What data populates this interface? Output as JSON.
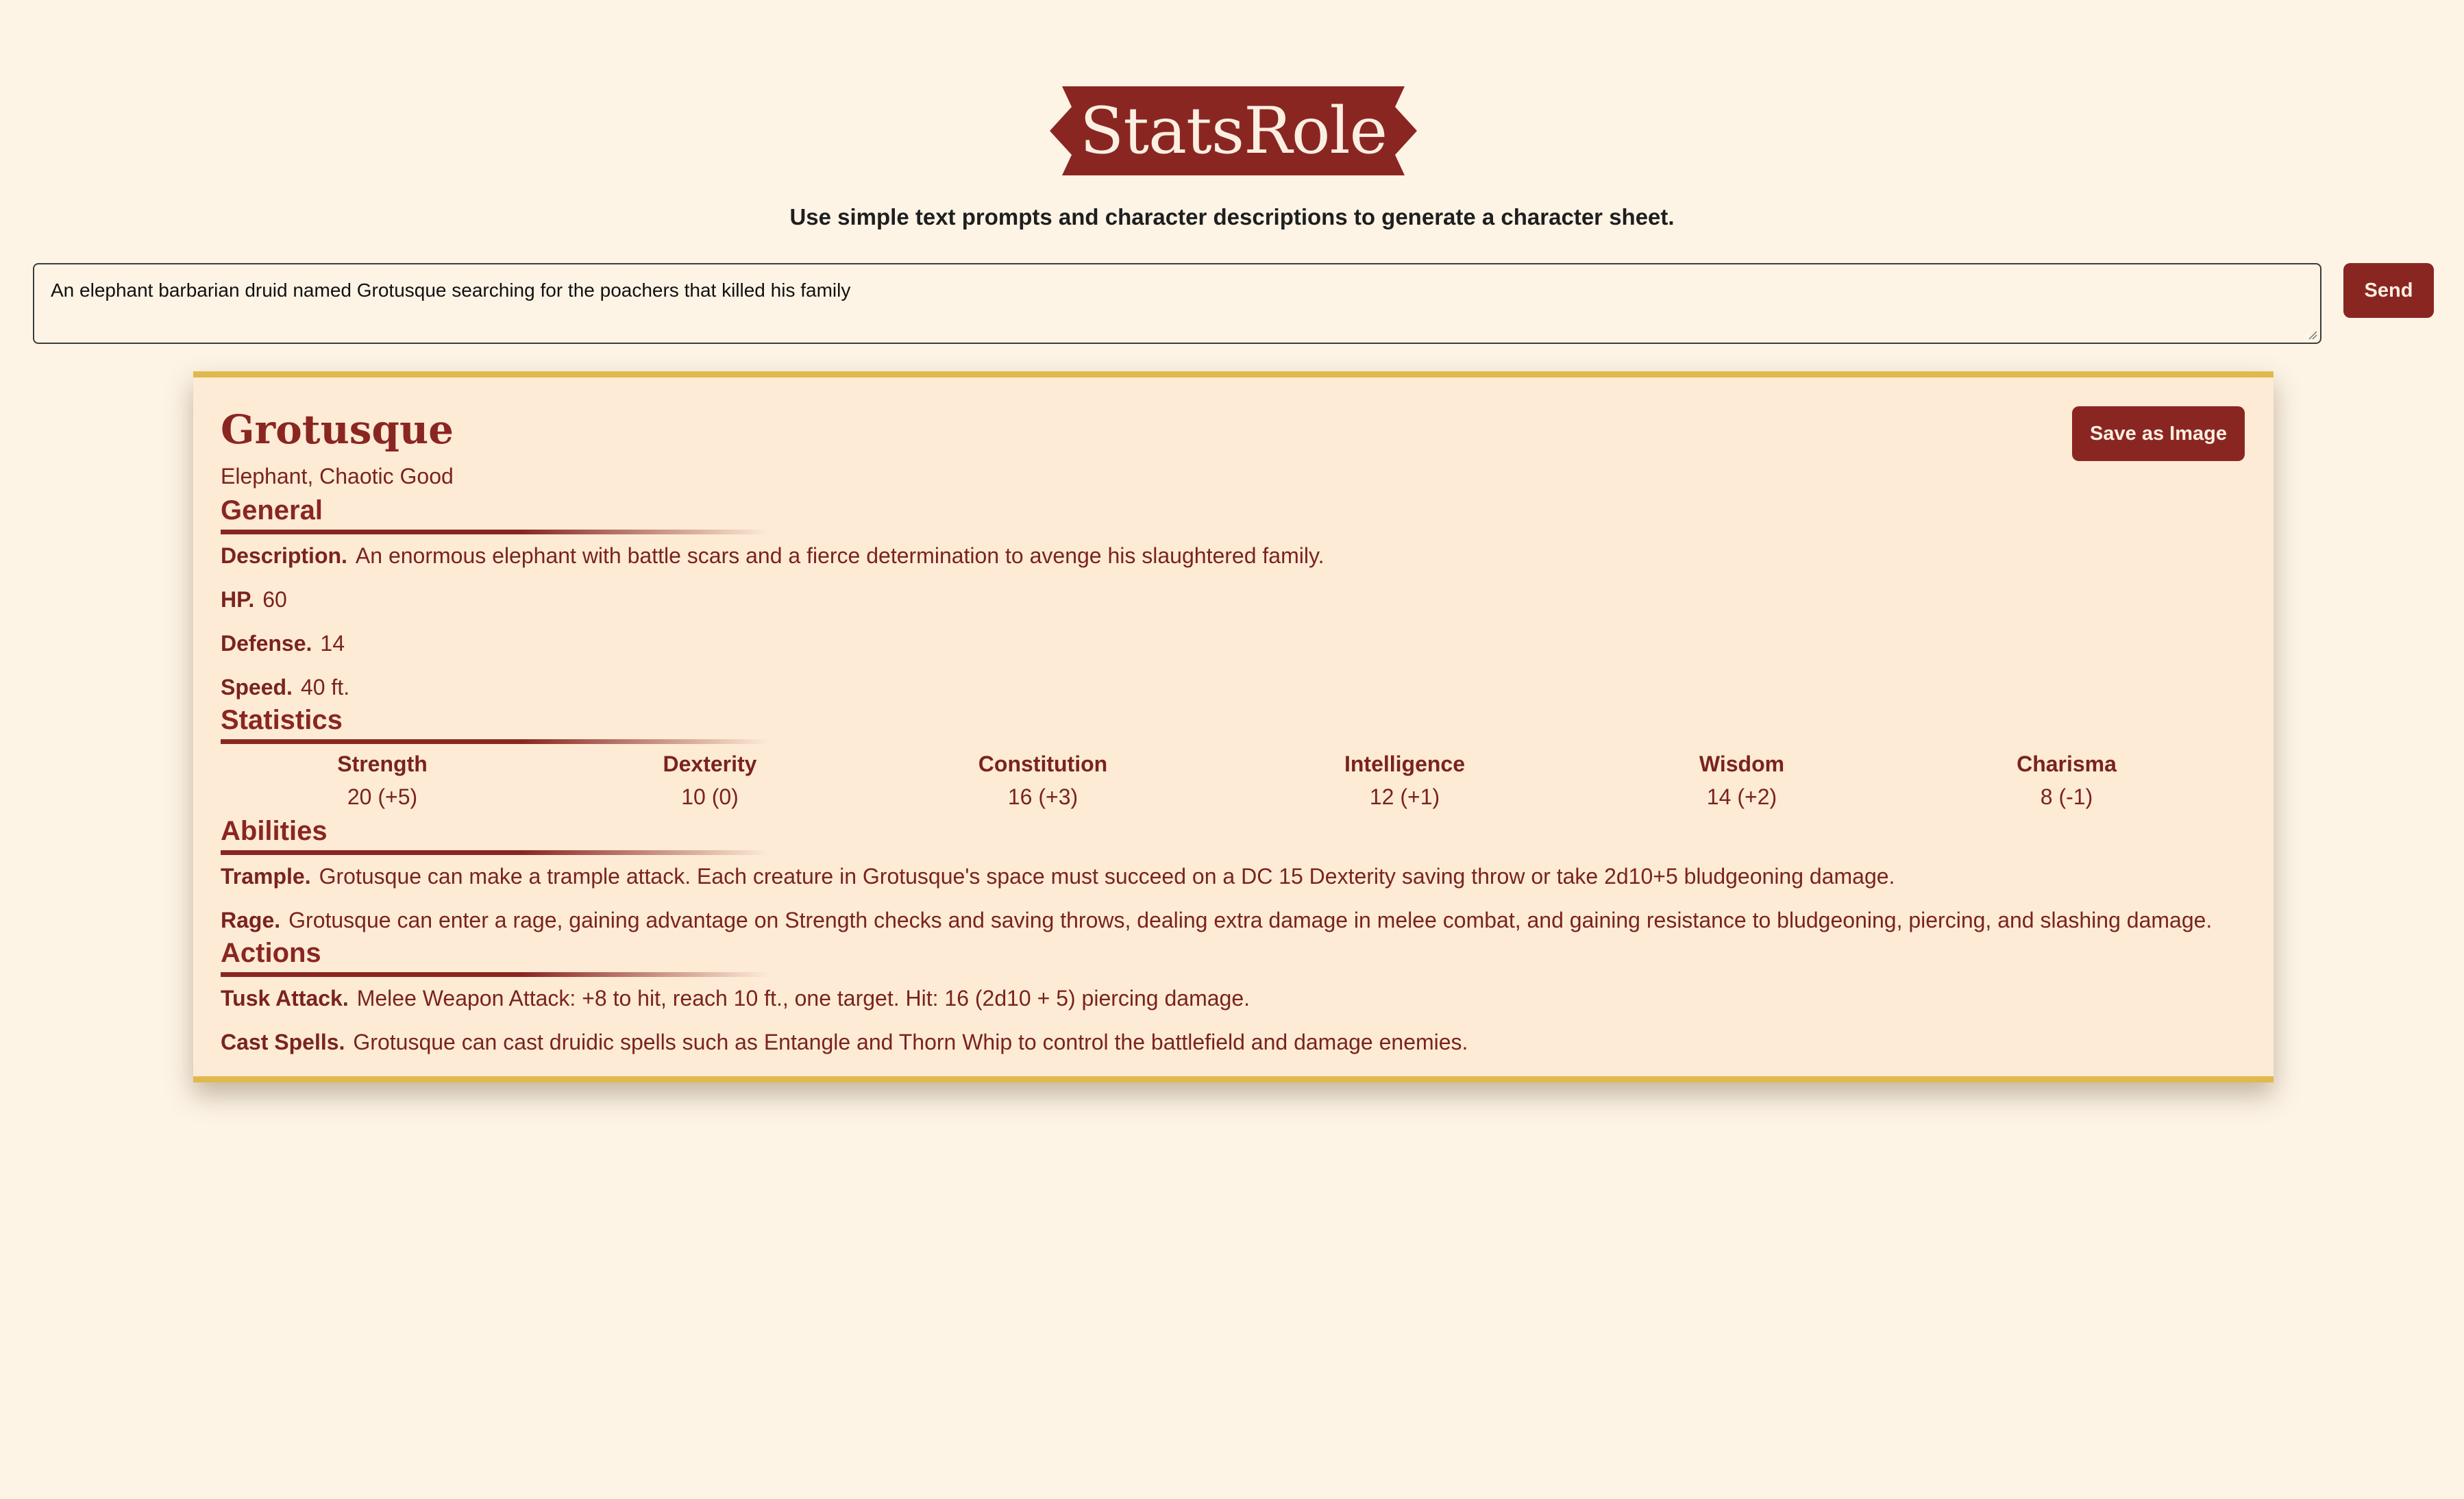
{
  "app": {
    "logo_text": "StatsRole",
    "tagline": "Use simple text prompts and character descriptions to generate a character sheet."
  },
  "prompt": {
    "value": "An elephant barbarian druid named Grotusque searching for the poachers that killed his family",
    "send_label": "Send"
  },
  "sheet": {
    "name": "Grotusque",
    "subtitle": "Elephant, Chaotic Good",
    "save_label": "Save as Image",
    "general": {
      "title": "General",
      "props": [
        {
          "label": "Description.",
          "value": "An enormous elephant with battle scars and a fierce determination to avenge his slaughtered family."
        },
        {
          "label": "HP.",
          "value": "60"
        },
        {
          "label": "Defense.",
          "value": "14"
        },
        {
          "label": "Speed.",
          "value": "40 ft."
        }
      ]
    },
    "statistics": {
      "title": "Statistics",
      "stats": [
        {
          "name": "Strength",
          "value": "20 (+5)"
        },
        {
          "name": "Dexterity",
          "value": "10 (0)"
        },
        {
          "name": "Constitution",
          "value": "16 (+3)"
        },
        {
          "name": "Intelligence",
          "value": "12 (+1)"
        },
        {
          "name": "Wisdom",
          "value": "14 (+2)"
        },
        {
          "name": "Charisma",
          "value": "8 (-1)"
        }
      ]
    },
    "abilities": {
      "title": "Abilities",
      "items": [
        {
          "label": "Trample.",
          "value": "Grotusque can make a trample attack. Each creature in Grotusque's space must succeed on a DC 15 Dexterity saving throw or take 2d10+5 bludgeoning damage."
        },
        {
          "label": "Rage.",
          "value": "Grotusque can enter a rage, gaining advantage on Strength checks and saving throws, dealing extra damage in melee combat, and gaining resistance to bludgeoning, piercing, and slashing damage."
        }
      ]
    },
    "actions": {
      "title": "Actions",
      "items": [
        {
          "label": "Tusk Attack.",
          "value": "Melee Weapon Attack: +8 to hit, reach 10 ft., one target. Hit: 16 (2d10 + 5) piercing damage."
        },
        {
          "label": "Cast Spells.",
          "value": "Grotusque can cast druidic spells such as Entangle and Thorn Whip to control the battlefield and damage enemies."
        }
      ]
    }
  },
  "colors": {
    "background": "#fdf4e6",
    "sheet_background": "#fdebd6",
    "accent": "#8a2621",
    "border_gold": "#e0b94c",
    "text": "#7a2320"
  }
}
